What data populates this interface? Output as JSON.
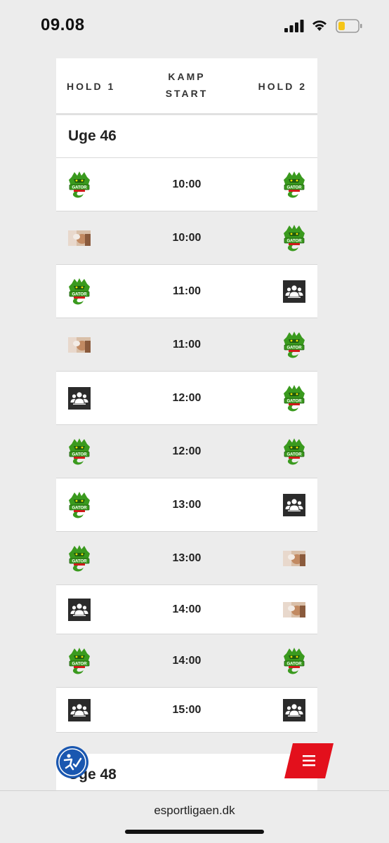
{
  "status_bar": {
    "time": "09.08"
  },
  "table": {
    "headers": {
      "team1": "HOLD 1",
      "kickoff_line1": "KAMP",
      "kickoff_line2": "START",
      "team2": "HOLD 2"
    },
    "weeks": [
      {
        "label": "Uge 46"
      },
      {
        "label": "Uge 48"
      }
    ],
    "matches": [
      {
        "time": "10:00",
        "left": "gator-logo",
        "right": "gator-logo"
      },
      {
        "time": "10:00",
        "left": "photo-avatar",
        "right": "gator-logo"
      },
      {
        "time": "11:00",
        "left": "gator-logo",
        "right": "group-icon"
      },
      {
        "time": "11:00",
        "left": "photo-avatar",
        "right": "gator-logo"
      },
      {
        "time": "12:00",
        "left": "group-icon",
        "right": "gator-logo"
      },
      {
        "time": "12:00",
        "left": "gator-logo",
        "right": "gator-logo"
      },
      {
        "time": "13:00",
        "left": "gator-logo",
        "right": "group-icon"
      },
      {
        "time": "13:00",
        "left": "gator-logo",
        "right": "photo-avatar"
      },
      {
        "time": "14:00",
        "left": "group-icon",
        "right": "photo-avatar"
      },
      {
        "time": "14:00",
        "left": "gator-logo",
        "right": "gator-logo"
      },
      {
        "time": "15:00",
        "left": "group-icon",
        "right": "group-icon"
      }
    ],
    "gator_logo_text": "GATOR"
  },
  "browser": {
    "url": "esportligaen.dk"
  },
  "colors": {
    "accent_blue": "#1a57b0",
    "menu_red": "#e3101c",
    "gator_green": "#3a9a1e"
  }
}
